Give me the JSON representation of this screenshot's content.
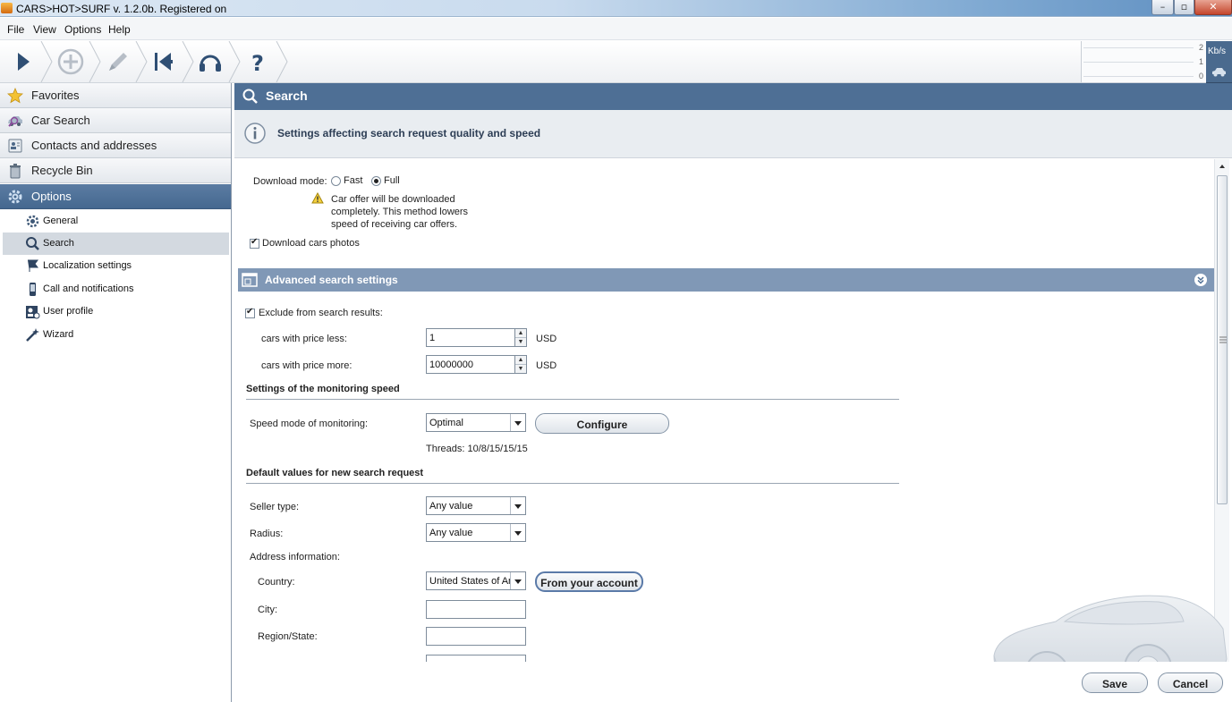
{
  "window": {
    "title": "CARS>HOT>SURF v. 1.2.0b. Registered on",
    "minimize_glyph": "–",
    "maximize_glyph": "▫",
    "close_glyph": "✕"
  },
  "menu": [
    "File",
    "View",
    "Options",
    "Help"
  ],
  "toolbar": {
    "buttons": [
      "play-icon",
      "add-icon",
      "edit-icon",
      "skip-back-icon",
      "headset-icon",
      "help-icon"
    ],
    "help_glyph": "?"
  },
  "speed": {
    "scale": [
      "2",
      "1",
      "0"
    ],
    "unit": "Kb/s"
  },
  "sidebar": {
    "sections": [
      {
        "label": "Favorites",
        "icon": "star-icon"
      },
      {
        "label": "Car Search",
        "icon": "car-search-icon"
      },
      {
        "label": "Contacts and addresses",
        "icon": "contacts-icon"
      },
      {
        "label": "Recycle Bin",
        "icon": "trash-icon"
      },
      {
        "label": "Options",
        "icon": "gear-icon",
        "active": true
      }
    ],
    "options_items": [
      {
        "label": "General",
        "icon": "gear-icon"
      },
      {
        "label": "Search",
        "icon": "search-icon",
        "active": true
      },
      {
        "label": "Localization settings",
        "icon": "flag-icon"
      },
      {
        "label": "Call and notifications",
        "icon": "phone-icon"
      },
      {
        "label": "User profile",
        "icon": "user-card-icon"
      },
      {
        "label": "Wizard",
        "icon": "wand-icon"
      }
    ]
  },
  "main": {
    "title": "Search",
    "info": "Settings affecting search request quality and speed",
    "download_mode": {
      "label": "Download mode:",
      "options": [
        "Fast",
        "Full"
      ],
      "selected": "Full",
      "warning": [
        "Car offer will be downloaded",
        "completely. This method lowers",
        "speed of receiving car offers."
      ]
    },
    "download_photos": {
      "label": "Download cars photos",
      "checked": true
    },
    "advanced": {
      "title": "Advanced search settings",
      "exclude": {
        "label": "Exclude from search results:",
        "checked": true
      },
      "price_less": {
        "label": "cars with price less:",
        "value": "1",
        "unit": "USD"
      },
      "price_more": {
        "label": "cars with price more:",
        "value": "10000000",
        "unit": "USD"
      },
      "monitoring": {
        "heading": "Settings of the monitoring speed",
        "speed_label": "Speed mode of monitoring:",
        "speed_value": "Optimal",
        "configure": "Configure",
        "threads": "Threads: 10/8/15/15/15"
      },
      "defaults": {
        "heading": "Default values for new search request",
        "seller_label": "Seller type:",
        "seller_value": "Any value",
        "radius_label": "Radius:",
        "radius_value": "Any value",
        "address_label": "Address information:",
        "country_label": "Country:",
        "country_value": "United States of Am",
        "from_account": "From your account",
        "city_label": "City:",
        "city_value": "",
        "region_label": "Region/State:",
        "region_value": ""
      }
    }
  },
  "footer": {
    "save": "Save",
    "cancel": "Cancel"
  },
  "colors": {
    "header_blue": "#4e6f95",
    "advanced_bar": "#8098b6",
    "sidebar_active": "#45688f"
  }
}
